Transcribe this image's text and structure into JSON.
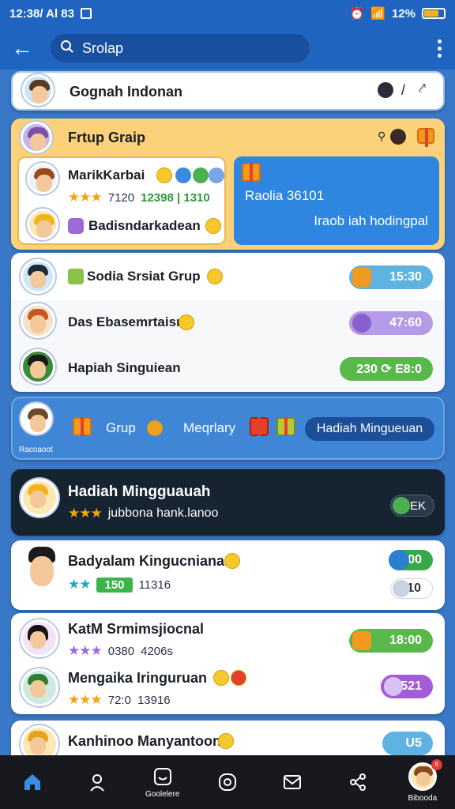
{
  "status_bar": {
    "time": "12:38/ Al 83",
    "battery": "12%"
  },
  "app_bar": {
    "search_text": "Srolap"
  },
  "top_card": {
    "name": "Gognah Indonan",
    "action": "/"
  },
  "group": {
    "title": "Frtup Graip",
    "member_1": {
      "name": "MarikKarbai",
      "meta_a": "7120",
      "meta_b": "12398 | 1310"
    },
    "member_2": {
      "name": "Badisndarkadean"
    },
    "reward_panel": {
      "title": "Raolia 36101",
      "subtitle": "Iraob iah hodingpal"
    }
  },
  "list_1": [
    {
      "name": "Sodia Srsiat Grup",
      "pill": "15:30",
      "pill_color": "#5fb3e0"
    },
    {
      "name": "Das Ebasemrtaisn",
      "pill": "47:60",
      "pill_color": "#b59ae6"
    },
    {
      "name": "Hapiah Singuiean",
      "pill": "230 ⟳ E8:0",
      "pill_color": "#58b84a"
    }
  ],
  "weekly_bar": {
    "avatar_label": "Racoaoot",
    "group_label": "Grup",
    "mid_label": "Meqrlary",
    "button": "Hadiah Mingueuan"
  },
  "highlight": {
    "title": "Hadiah Mingguauah",
    "subtitle": "jubbona hank.lanoo",
    "pill": "EK"
  },
  "list_2": [
    {
      "name": "Badyalam Kingucnianar",
      "meta_a": "150",
      "meta_b": "11316",
      "pill": "00",
      "pill2": "10"
    },
    {
      "name": "KatM Srmimsjiocnal",
      "meta_a": "0380",
      "meta_b": "4206s",
      "pill": "18:00"
    },
    {
      "name": "Mengaika Iringuruan",
      "meta_a": "72:0",
      "meta_b": "13916",
      "pill": "521"
    },
    {
      "name": "Kanhinoo Manyantoona.",
      "pill": "U5"
    }
  ],
  "nav": {
    "label_2": "Goolelere",
    "label_5": "Bibooda",
    "badge": "6"
  }
}
